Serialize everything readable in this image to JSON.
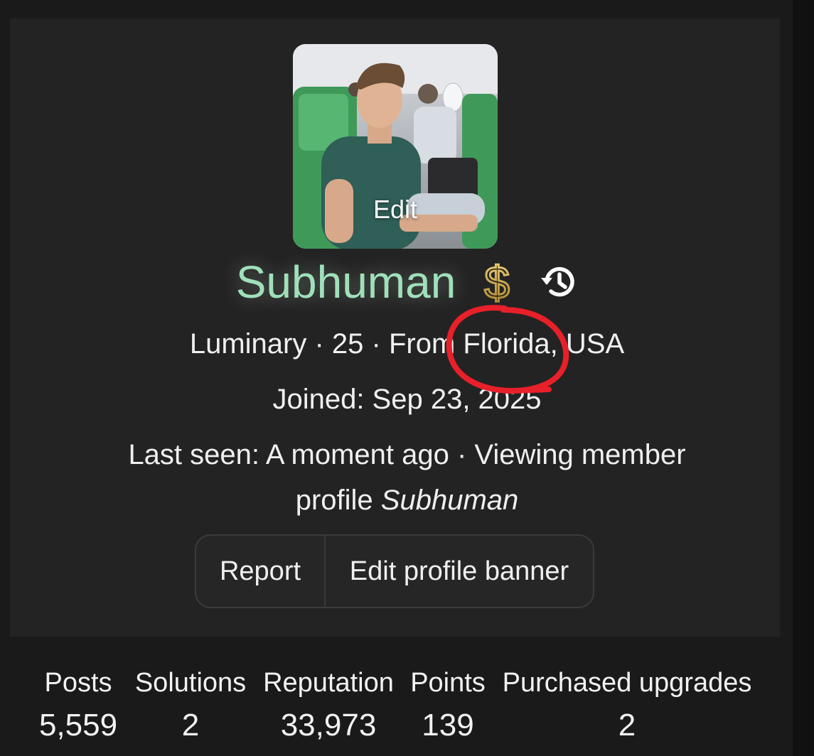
{
  "avatar": {
    "edit_label": "Edit"
  },
  "profile": {
    "username": "Subhuman",
    "username_color": "#9fe0ba",
    "badge_icon": "dollar-sign-icon",
    "history_icon": "history-icon",
    "info_line": "Luminary · 25 · From Florida, USA",
    "joined": "Joined: Sep 23, 2025",
    "last_seen_prefix": "Last seen: A moment ago · Viewing member",
    "last_seen_suffix_plain": "profile ",
    "last_seen_suffix_italic": "Subhuman"
  },
  "actions": {
    "report_label": "Report",
    "edit_banner_label": "Edit profile banner"
  },
  "stats": {
    "posts_label": "Posts",
    "posts_value": "5,559",
    "solutions_label": "Solutions",
    "solutions_value": "2",
    "reputation_label": "Reputation",
    "reputation_value": "33,973",
    "points_label": "Points",
    "points_value": "139",
    "upgrades_label": "Purchased upgrades",
    "upgrades_value": "2"
  },
  "colors": {
    "annotation": "#e8202a",
    "background": "#1a1a1a",
    "card": "#232323"
  }
}
